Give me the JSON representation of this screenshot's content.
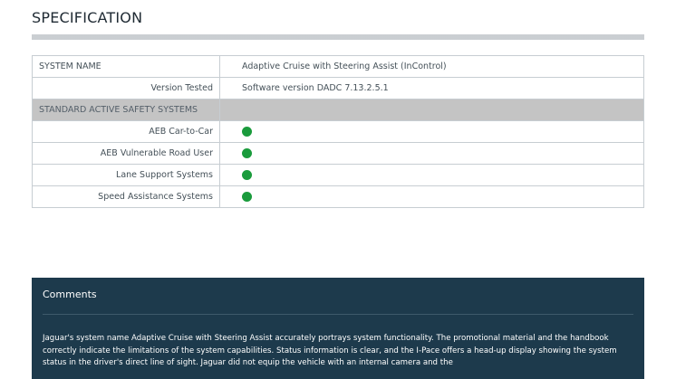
{
  "heading": "SPECIFICATION",
  "spec": {
    "system_name_label": "SYSTEM NAME",
    "system_name_value": "Adaptive Cruise with Steering Assist (InControl)",
    "version_label": "Version Tested",
    "version_value": "Software version DADC 7.13.2.5.1",
    "section_label": "STANDARD ACTIVE SAFETY SYSTEMS",
    "status_color": "#1a9b3c",
    "systems": [
      {
        "label": "AEB Car-to-Car",
        "status": "green"
      },
      {
        "label": "AEB Vulnerable Road User",
        "status": "green"
      },
      {
        "label": "Lane Support Systems",
        "status": "green"
      },
      {
        "label": "Speed Assistance Systems",
        "status": "green"
      }
    ]
  },
  "comments": {
    "title": "Comments",
    "text": "Jaguar's system name Adaptive Cruise with Steering Assist accurately portrays system functionality. The promotional material and the handbook correctly indicate the limitations of the system capabilities. Status information is clear, and the I-Pace offers a head-up display showing the system status in the driver's direct line of sight. Jaguar did not equip the vehicle with an internal camera and the"
  }
}
